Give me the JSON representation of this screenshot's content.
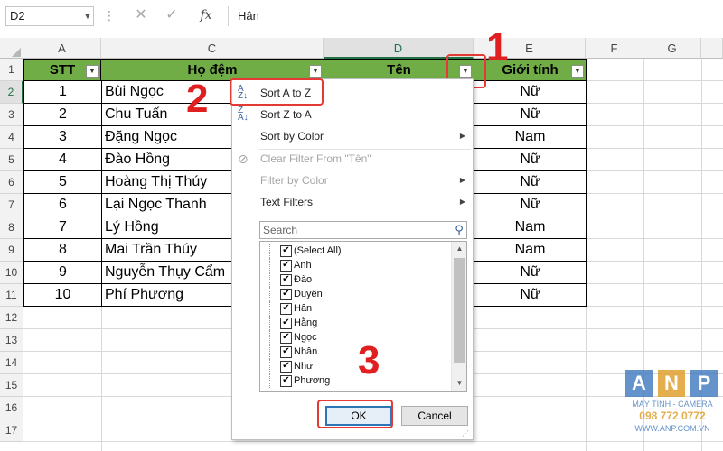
{
  "formula_bar": {
    "name_box": "D2",
    "fx": "fx",
    "value": "Hân"
  },
  "columns": [
    "A",
    "C",
    "D",
    "E",
    "F",
    "G"
  ],
  "rows": [
    "1",
    "2",
    "3",
    "4",
    "5",
    "6",
    "7",
    "8",
    "9",
    "10",
    "11",
    "12",
    "13",
    "14",
    "15",
    "16",
    "17"
  ],
  "headers": {
    "stt": "STT",
    "ho_dem": "Họ đệm",
    "ten": "Tên",
    "gioi_tinh": "Giới tính"
  },
  "table": [
    {
      "stt": "1",
      "ho_dem": "Bùi Ngọc",
      "gioi_tinh": "Nữ"
    },
    {
      "stt": "2",
      "ho_dem": "Chu Tuấn",
      "gioi_tinh": "Nữ"
    },
    {
      "stt": "3",
      "ho_dem": "Đặng Ngọc",
      "gioi_tinh": "Nam"
    },
    {
      "stt": "4",
      "ho_dem": "Đào Hồng",
      "gioi_tinh": "Nữ"
    },
    {
      "stt": "5",
      "ho_dem": "Hoàng Thị Thúy",
      "gioi_tinh": "Nữ"
    },
    {
      "stt": "6",
      "ho_dem": "Lại Ngọc Thanh",
      "gioi_tinh": "Nữ"
    },
    {
      "stt": "7",
      "ho_dem": "Lý Hồng",
      "gioi_tinh": "Nam"
    },
    {
      "stt": "8",
      "ho_dem": "Mai Trần Thúy",
      "gioi_tinh": "Nam"
    },
    {
      "stt": "9",
      "ho_dem": "Nguyễn Thụy Cẩm",
      "gioi_tinh": "Nữ"
    },
    {
      "stt": "10",
      "ho_dem": "Phí Phương",
      "gioi_tinh": "Nữ"
    }
  ],
  "menu": {
    "sort_az": "Sort A to Z",
    "sort_za": "Sort Z to A",
    "sort_color": "Sort by Color",
    "clear_filter": "Clear Filter From \"Tên\"",
    "filter_color": "Filter by Color",
    "text_filters": "Text Filters",
    "search_placeholder": "Search",
    "items": [
      "(Select All)",
      "Anh",
      "Đào",
      "Duyên",
      "Hân",
      "Hằng",
      "Ngọc",
      "Nhân",
      "Như",
      "Phương"
    ],
    "ok": "OK",
    "cancel": "Cancel"
  },
  "annotations": {
    "step1": "1",
    "step2": "2",
    "step3": "3"
  },
  "watermark": {
    "letters": [
      "A",
      "N",
      "P"
    ],
    "tagline": "MÁY TÍNH - CAMERA",
    "phone": "098 772 0772",
    "url": "WWW.ANP.COM.VN"
  },
  "colors": {
    "header_fill": "#70ad47",
    "annotation": "#e02020",
    "excel_green": "#217346"
  }
}
